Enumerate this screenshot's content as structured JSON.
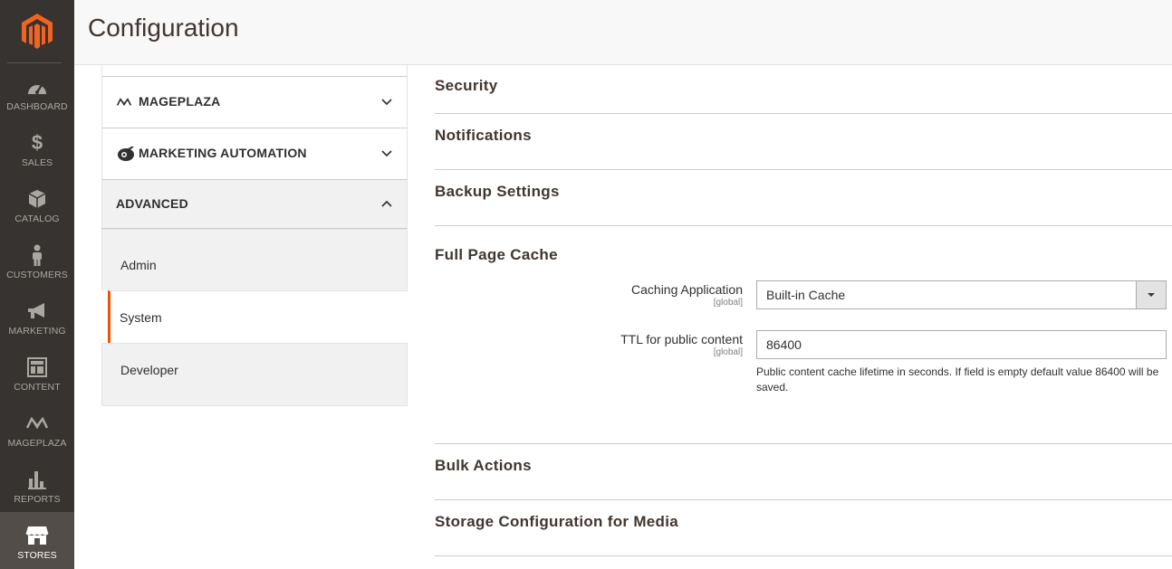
{
  "nav": {
    "items": [
      {
        "label": "DASHBOARD",
        "icon": "dashboard-icon"
      },
      {
        "label": "SALES",
        "icon": "dollar-icon"
      },
      {
        "label": "CATALOG",
        "icon": "box-icon"
      },
      {
        "label": "CUSTOMERS",
        "icon": "person-icon"
      },
      {
        "label": "MARKETING",
        "icon": "megaphone-icon"
      },
      {
        "label": "CONTENT",
        "icon": "layout-icon"
      },
      {
        "label": "MAGEPLAZA",
        "icon": "mageplaza-icon"
      },
      {
        "label": "REPORTS",
        "icon": "bar-chart-icon"
      },
      {
        "label": "STORES",
        "icon": "store-icon"
      }
    ],
    "active": "STORES"
  },
  "header": {
    "title": "Configuration"
  },
  "config_sidebar": {
    "tabs": [
      {
        "label": "MAGEPLAZA",
        "icon": "mageplaza-icon"
      },
      {
        "label": "MARKETING AUTOMATION",
        "icon": "marketing-automation-icon"
      },
      {
        "label": "ADVANCED"
      }
    ],
    "advanced_items": [
      {
        "label": "Admin"
      },
      {
        "label": "System"
      },
      {
        "label": "Developer"
      }
    ],
    "active_item": "System"
  },
  "sections": {
    "security": "Security",
    "notifications": "Notifications",
    "backup": "Backup Settings",
    "full_page_cache": "Full Page Cache",
    "bulk_actions": "Bulk Actions",
    "storage": "Storage Configuration for Media"
  },
  "full_page_cache": {
    "caching_app": {
      "label": "Caching Application",
      "scope": "[global]",
      "value": "Built-in Cache"
    },
    "ttl": {
      "label": "TTL for public content",
      "scope": "[global]",
      "value": "86400",
      "note": "Public content cache lifetime in seconds. If field is empty default value 86400 will be saved."
    }
  },
  "colors": {
    "nav_bg": "#373330",
    "accent": "#eb5202",
    "logo": "#f26322"
  }
}
